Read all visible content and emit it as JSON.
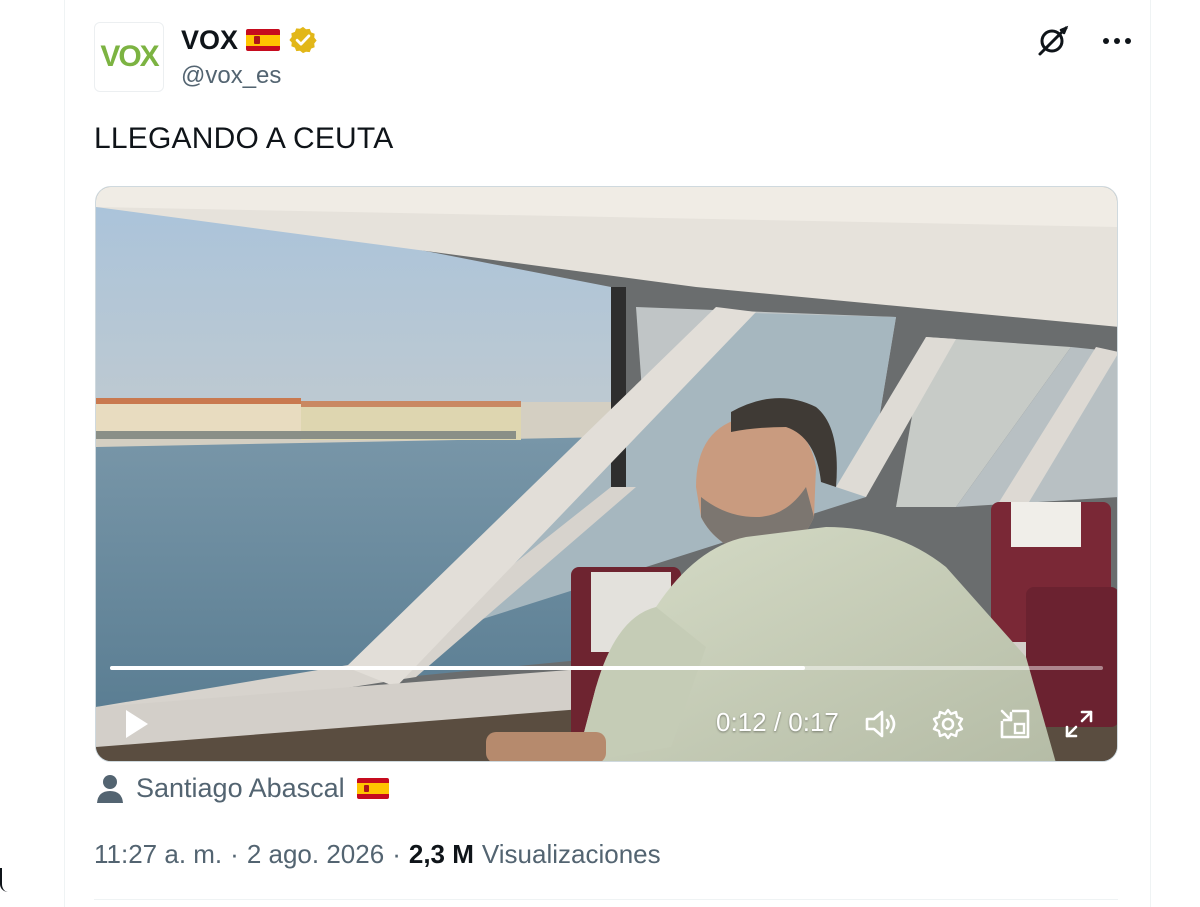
{
  "tweet": {
    "author": {
      "avatar_text": "VOX",
      "display_name": "VOX",
      "handle": "@vox_es",
      "flag_icon": "spain-flag-icon",
      "verified_icon": "gold-verified-badge-icon",
      "verified_color": "#e2b719"
    },
    "actions": {
      "grok_icon": "grok-icon",
      "more_icon": "more-options-icon"
    },
    "text": "LLEGANDO A CEUTA",
    "video": {
      "current_time": "0:12",
      "duration": "0:17",
      "time_display": "0:12 / 0:17",
      "progress_fraction": 0.7,
      "controls": [
        "play-icon",
        "volume-icon",
        "settings-gear-icon",
        "picture-in-picture-icon",
        "fullscreen-icon"
      ]
    },
    "tagged_user": {
      "icon": "person-icon",
      "name": "Santiago Abascal",
      "flag_icon": "spain-flag-icon"
    },
    "meta": {
      "time": "11:27 a. m.",
      "separator": "·",
      "date": "2 ago. 2026",
      "views_count": "2,3 M",
      "views_label": "Visualizaciones"
    }
  },
  "colors": {
    "text_primary": "#0f1419",
    "text_secondary": "#536471",
    "border": "#eff3f4",
    "vox_green": "#7cb342"
  }
}
